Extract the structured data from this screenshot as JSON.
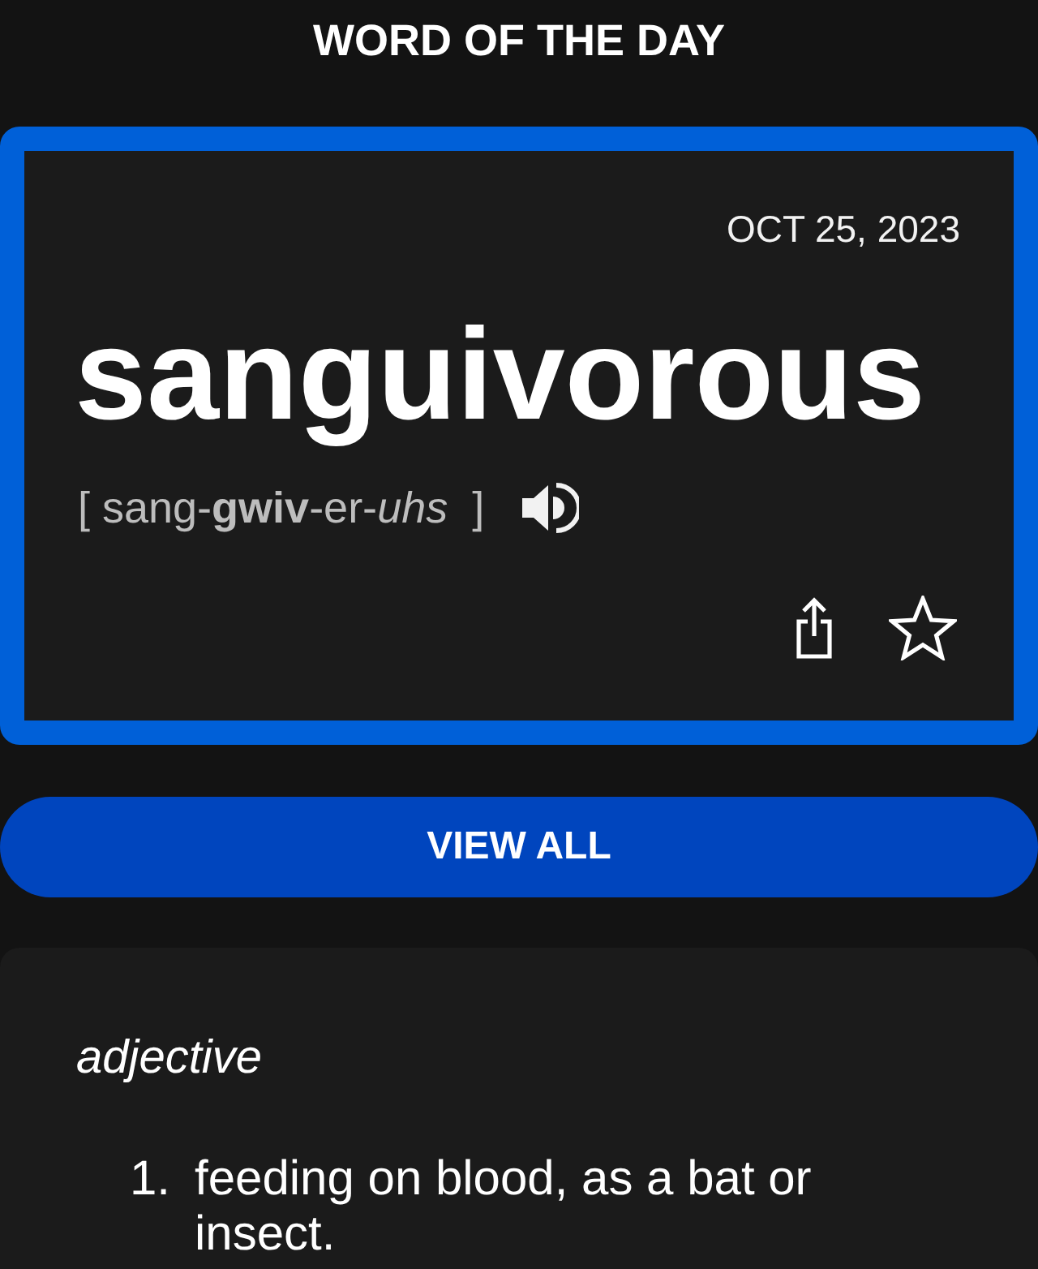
{
  "header": {
    "title": "WORD OF THE DAY"
  },
  "word_card": {
    "date": "OCT 25, 2023",
    "word": "sanguivorous",
    "pronunciation": "[ sang-**gwiv**-er-*uhs*  ]",
    "favorite": false
  },
  "view_all_button": {
    "label": "VIEW ALL"
  },
  "definition": {
    "part_of_speech": "adjective",
    "senses": [
      {
        "number": "1.",
        "text": "feeding on blood, as a bat or insect."
      }
    ]
  }
}
